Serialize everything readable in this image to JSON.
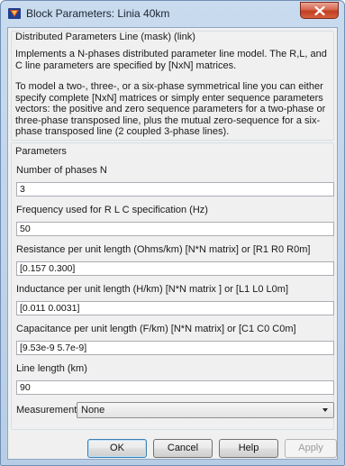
{
  "window": {
    "title": "Block Parameters: Linia 40km",
    "close_symbol": "x"
  },
  "description_group": {
    "title": "Distributed Parameters Line (mask) (link)",
    "paragraph1": "Implements a N-phases distributed parameter line model. The R,L, and C line parameters are specified by [NxN] matrices.",
    "paragraph2": "To model a two-, three-, or a six-phase symmetrical line you can either specify complete [NxN] matrices or simply enter sequence parameters vectors: the positive and zero sequence parameters for a two-phase or three-phase transposed line, plus the mutual zero-sequence for a six-phase transposed line (2 coupled 3-phase lines)."
  },
  "parameters_group": {
    "title": "Parameters",
    "fields": [
      {
        "label": "Number of phases N",
        "value": "3"
      },
      {
        "label": "Frequency used for R L C specification (Hz)",
        "value": "50"
      },
      {
        "label": "Resistance per unit length (Ohms/km)  [N*N matrix] or [R1 R0 R0m]",
        "value": "[0.157 0.300]"
      },
      {
        "label": "Inductance per unit length (H/km) [N*N matrix ] or [L1 L0 L0m]",
        "value": "[0.011 0.0031]"
      },
      {
        "label": "Capacitance per unit length (F/km) [N*N matrix] or [C1 C0 C0m]",
        "value": "[9.53e-9  5.7e-9]"
      },
      {
        "label": "Line length (km)",
        "value": "90"
      }
    ],
    "measurements": {
      "label": "Measurements",
      "value": "None"
    }
  },
  "buttons": {
    "ok": "OK",
    "cancel": "Cancel",
    "help": "Help",
    "apply": "Apply"
  }
}
